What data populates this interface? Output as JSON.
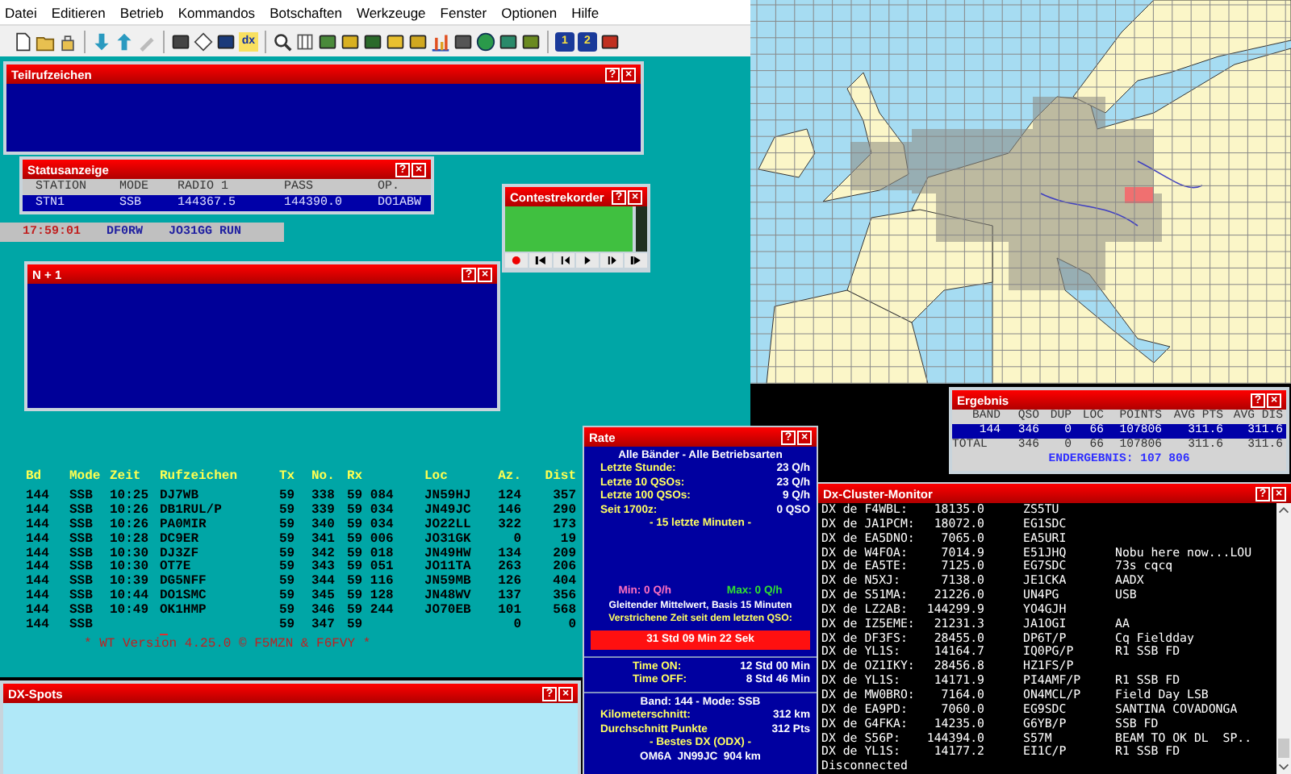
{
  "menu": [
    "Datei",
    "Editieren",
    "Betrieb",
    "Kommandos",
    "Botschaften",
    "Werkzeuge",
    "Fenster",
    "Optionen",
    "Hilfe"
  ],
  "toolbar": {
    "dx_button": "dx",
    "radio_buttons": [
      "1",
      "2"
    ]
  },
  "partial_calls": {
    "title": "Teilrufzeichen",
    "help": "?",
    "close": "×"
  },
  "status": {
    "title": "Statusanzeige",
    "help": "?",
    "close": "×",
    "columns": [
      "STATION",
      "MODE",
      "RADIO 1",
      "PASS",
      "OP."
    ],
    "row": [
      "STN1",
      "SSB",
      "144367.5",
      "144390.0",
      "DO1ABW"
    ]
  },
  "clock_bar": {
    "time": "17:59:01",
    "call": "DF0RW",
    "info": "JO31GG RUN"
  },
  "recorder": {
    "title": "Contestrekorder",
    "help": "?",
    "close": "×"
  },
  "n_plus_one": {
    "title": "N + 1",
    "help": "?",
    "close": "×"
  },
  "log": {
    "columns": [
      "Bd",
      "Mode",
      "Zeit",
      "Rufzeichen",
      "Tx",
      "No.",
      "Rx",
      "Loc",
      "Az.",
      "Dist"
    ],
    "rows": [
      [
        "144",
        "SSB",
        "10:25",
        "DJ7WB",
        "59",
        "338",
        "59 084",
        "JN59HJ",
        "124",
        "357"
      ],
      [
        "144",
        "SSB",
        "10:26",
        "DB1RUL/P",
        "59",
        "339",
        "59 034",
        "JN49JC",
        "146",
        "290"
      ],
      [
        "144",
        "SSB",
        "10:26",
        "PA0MIR",
        "59",
        "340",
        "59 034",
        "JO22LL",
        "322",
        "173"
      ],
      [
        "144",
        "SSB",
        "10:28",
        "DC9ER",
        "59",
        "341",
        "59 006",
        "JO31GK",
        "0",
        "19"
      ],
      [
        "144",
        "SSB",
        "10:30",
        "DJ3ZF",
        "59",
        "342",
        "59 018",
        "JN49HW",
        "134",
        "209"
      ],
      [
        "144",
        "SSB",
        "10:30",
        "OT7E",
        "59",
        "343",
        "59 051",
        "JO11TA",
        "263",
        "206"
      ],
      [
        "144",
        "SSB",
        "10:39",
        "DG5NFF",
        "59",
        "344",
        "59 116",
        "JN59MB",
        "126",
        "404"
      ],
      [
        "144",
        "SSB",
        "10:44",
        "DO1SMC",
        "59",
        "345",
        "59 128",
        "JN48WV",
        "137",
        "356"
      ],
      [
        "144",
        "SSB",
        "10:49",
        "OK1HMP",
        "59",
        "346",
        "59 244",
        "JO70EB",
        "101",
        "568"
      ],
      [
        "144",
        "SSB",
        null,
        null,
        "59",
        "347",
        "59",
        null,
        "0",
        "0"
      ]
    ],
    "version": "* WT Version 4.25.0 © F5MZN & F6FVY *"
  },
  "rate": {
    "title": "Rate",
    "help": "?",
    "close": "×",
    "heading": "Alle Bänder - Alle Betriebsarten",
    "stats": [
      {
        "label": "Letzte Stunde:",
        "value": "23 Q/h"
      },
      {
        "label": "Letzte 10 QSOs:",
        "value": "23 Q/h"
      },
      {
        "label": "Letzte 100 QSOs:",
        "value": "9 Q/h"
      },
      {
        "label": "Seit 1700z:",
        "value": "0 QSO"
      }
    ],
    "minutes": "- 15 letzte Minuten -",
    "min": "Min: 0 Q/h",
    "max": "Max: 0 Q/h",
    "average": "Gleitender Mittelwert, Basis 15 Minuten",
    "elapsed_label": "Verstrichene Zeit seit dem letzten QSO:",
    "elapsed": "31 Std 09 Min 22 Sek",
    "times": [
      {
        "label": "Time ON:",
        "value": "12 Std 00 Min"
      },
      {
        "label": "Time OFF:",
        "value": "8 Std 46 Min"
      }
    ],
    "band": "Band: 144 - Mode: SSB",
    "averages": [
      {
        "label": "Kilometerschnitt:",
        "value": "312 km"
      },
      {
        "label": "Durchschnitt Punkte",
        "value": "312 Pts"
      }
    ],
    "odx_label": "- Bestes DX (ODX) -",
    "odx": "OM6A  JN99JC  904 km"
  },
  "result": {
    "title": "Ergebnis",
    "help": "?",
    "close": "×",
    "columns": [
      "BAND",
      "QSO",
      "DUP",
      "LOC",
      "POINTS",
      "AVG PTS",
      "AVG DIS"
    ],
    "rows": [
      {
        "cells": [
          "144",
          "346",
          "0",
          "66",
          "107806",
          "311.6",
          "311.6"
        ],
        "selected": true
      },
      {
        "cells": [
          "TOTAL",
          "346",
          "0",
          "66",
          "107806",
          "311.6",
          "311.6"
        ],
        "selected": false
      }
    ],
    "total": "ENDERGEBNIS: 107 806"
  },
  "cluster": {
    "title": "Dx-Cluster-Monitor",
    "help": "?",
    "close": "×",
    "spots": [
      {
        "spotter": "DX de F4WBL:",
        "freq": "18135.0",
        "call": "ZS5TU"
      },
      {
        "spotter": "DX de JA1PCM:",
        "freq": "18072.0",
        "call": "EG1SDC"
      },
      {
        "spotter": "DX de EA5DNO:",
        "freq": "7065.0",
        "call": "EA5URI"
      },
      {
        "spotter": "DX de W4FOA:",
        "freq": "7014.9",
        "call": "E51JHQ",
        "comment": "Nobu here now...LOU"
      },
      {
        "spotter": "DX de EA5TE:",
        "freq": "7125.0",
        "call": "EG7SDC",
        "comment": "73s cqcq"
      },
      {
        "spotter": "DX de N5XJ:",
        "freq": "7138.0",
        "call": "JE1CKA",
        "comment": "AADX"
      },
      {
        "spotter": "DX de S51MA:",
        "freq": "21226.0",
        "call": "UN4PG",
        "comment": "USB"
      },
      {
        "spotter": "DX de LZ2AB:",
        "freq": "144299.9",
        "call": "YO4GJH"
      },
      {
        "spotter": "DX de IZ5EME:",
        "freq": "21231.3",
        "call": "JA1OGI",
        "comment": "AA"
      },
      {
        "spotter": "DX de DF3FS:",
        "freq": "28455.0",
        "call": "DP6T/P",
        "comment": "Cq Fieldday"
      },
      {
        "spotter": "DX de YL1S:",
        "freq": "14164.7",
        "call": "IQ0PG/P",
        "comment": "R1 SSB FD"
      },
      {
        "spotter": "DX de OZ1IKY:",
        "freq": "28456.8",
        "call": "HZ1FS/P"
      },
      {
        "spotter": "DX de YL1S:",
        "freq": "14171.9",
        "call": "PI4AMF/P",
        "comment": "R1 SSB FD"
      },
      {
        "spotter": "DX de MW0BRO:",
        "freq": "7164.0",
        "call": "ON4MCL/P",
        "comment": "Field Day LSB"
      },
      {
        "spotter": "DX de EA9PD:",
        "freq": "7060.0",
        "call": "EG9SDC",
        "comment": "SANTINA COVADONGA"
      },
      {
        "spotter": "DX de G4FKA:",
        "freq": "14235.0",
        "call": "G6YB/P",
        "comment": "SSB FD"
      },
      {
        "spotter": "DX de S56P:",
        "freq": "144394.0",
        "call": "S57M",
        "comment": "BEAM TO OK DL  SP.."
      },
      {
        "spotter": "DX de YL1S:",
        "freq": "14177.2",
        "call": "EI1C/P",
        "comment": "R1 SSB FD"
      }
    ],
    "status_line": "Disconnected"
  },
  "dx_spots": {
    "title": "DX-Spots",
    "help": "?",
    "close": "×"
  }
}
